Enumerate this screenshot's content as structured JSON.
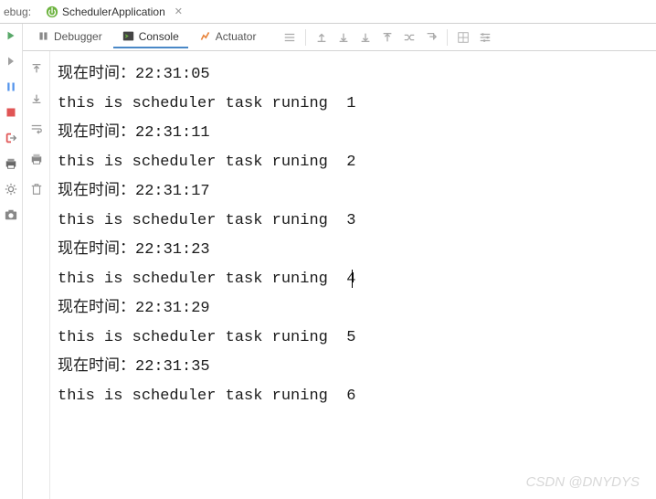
{
  "topbar": {
    "label": "ebug:",
    "tab_title": "SchedulerApplication"
  },
  "subtabs": {
    "debugger": "Debugger",
    "console": "Console",
    "actuator": "Actuator"
  },
  "console_lines": [
    "现在时间：22:31:05",
    "this is scheduler task runing  1",
    "现在时间：22:31:11",
    "this is scheduler task runing  2",
    "现在时间：22:31:17",
    "this is scheduler task runing  3",
    "现在时间：22:31:23",
    "this is scheduler task runing  4",
    "现在时间：22:31:29",
    "this is scheduler task runing  5",
    "现在时间：22:31:35",
    "this is scheduler task runing  6"
  ],
  "watermark": "CSDN @DNYDYS"
}
